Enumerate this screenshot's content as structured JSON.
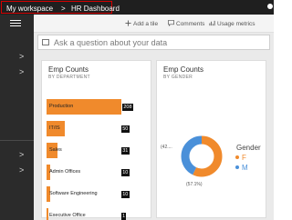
{
  "breadcrumb": {
    "workspace": "My workspace",
    "separator": ">",
    "dashboard": "HR Dashboard"
  },
  "toolbar": {
    "add_tile": "Add a tile",
    "comments": "Comments",
    "usage_metrics": "Usage metrics"
  },
  "qa": {
    "placeholder": "Ask a question about your data"
  },
  "nav": {
    "chevrons": [
      ">",
      ">",
      ">",
      ">"
    ]
  },
  "colors": {
    "accent": "#f08a2c",
    "female": "#f08a2c",
    "male": "#4a90d9",
    "nav": "#2b2b2b"
  },
  "tile_dept": {
    "title": "Emp Counts",
    "subtitle": "BY DEPARTMENT",
    "chart_data": {
      "type": "bar",
      "categories": [
        "Production",
        "IT/IS",
        "Sales",
        "Admin Offices",
        "Software Engineering",
        "Executive Office"
      ],
      "values": [
        208,
        50,
        31,
        10,
        10,
        1
      ]
    },
    "value_labels": [
      "208",
      "50",
      "31",
      "10",
      "10",
      "1"
    ]
  },
  "tile_gender": {
    "title": "Emp Counts",
    "subtitle": "BY GENDER",
    "chart_data": {
      "type": "pie",
      "categories": [
        "F",
        "M"
      ],
      "percent": [
        57.1,
        42.9
      ]
    },
    "label_left": "(42....",
    "label_bottom": "(57.1%)",
    "legend_title": "Gender",
    "legend": [
      "F",
      "M"
    ]
  }
}
